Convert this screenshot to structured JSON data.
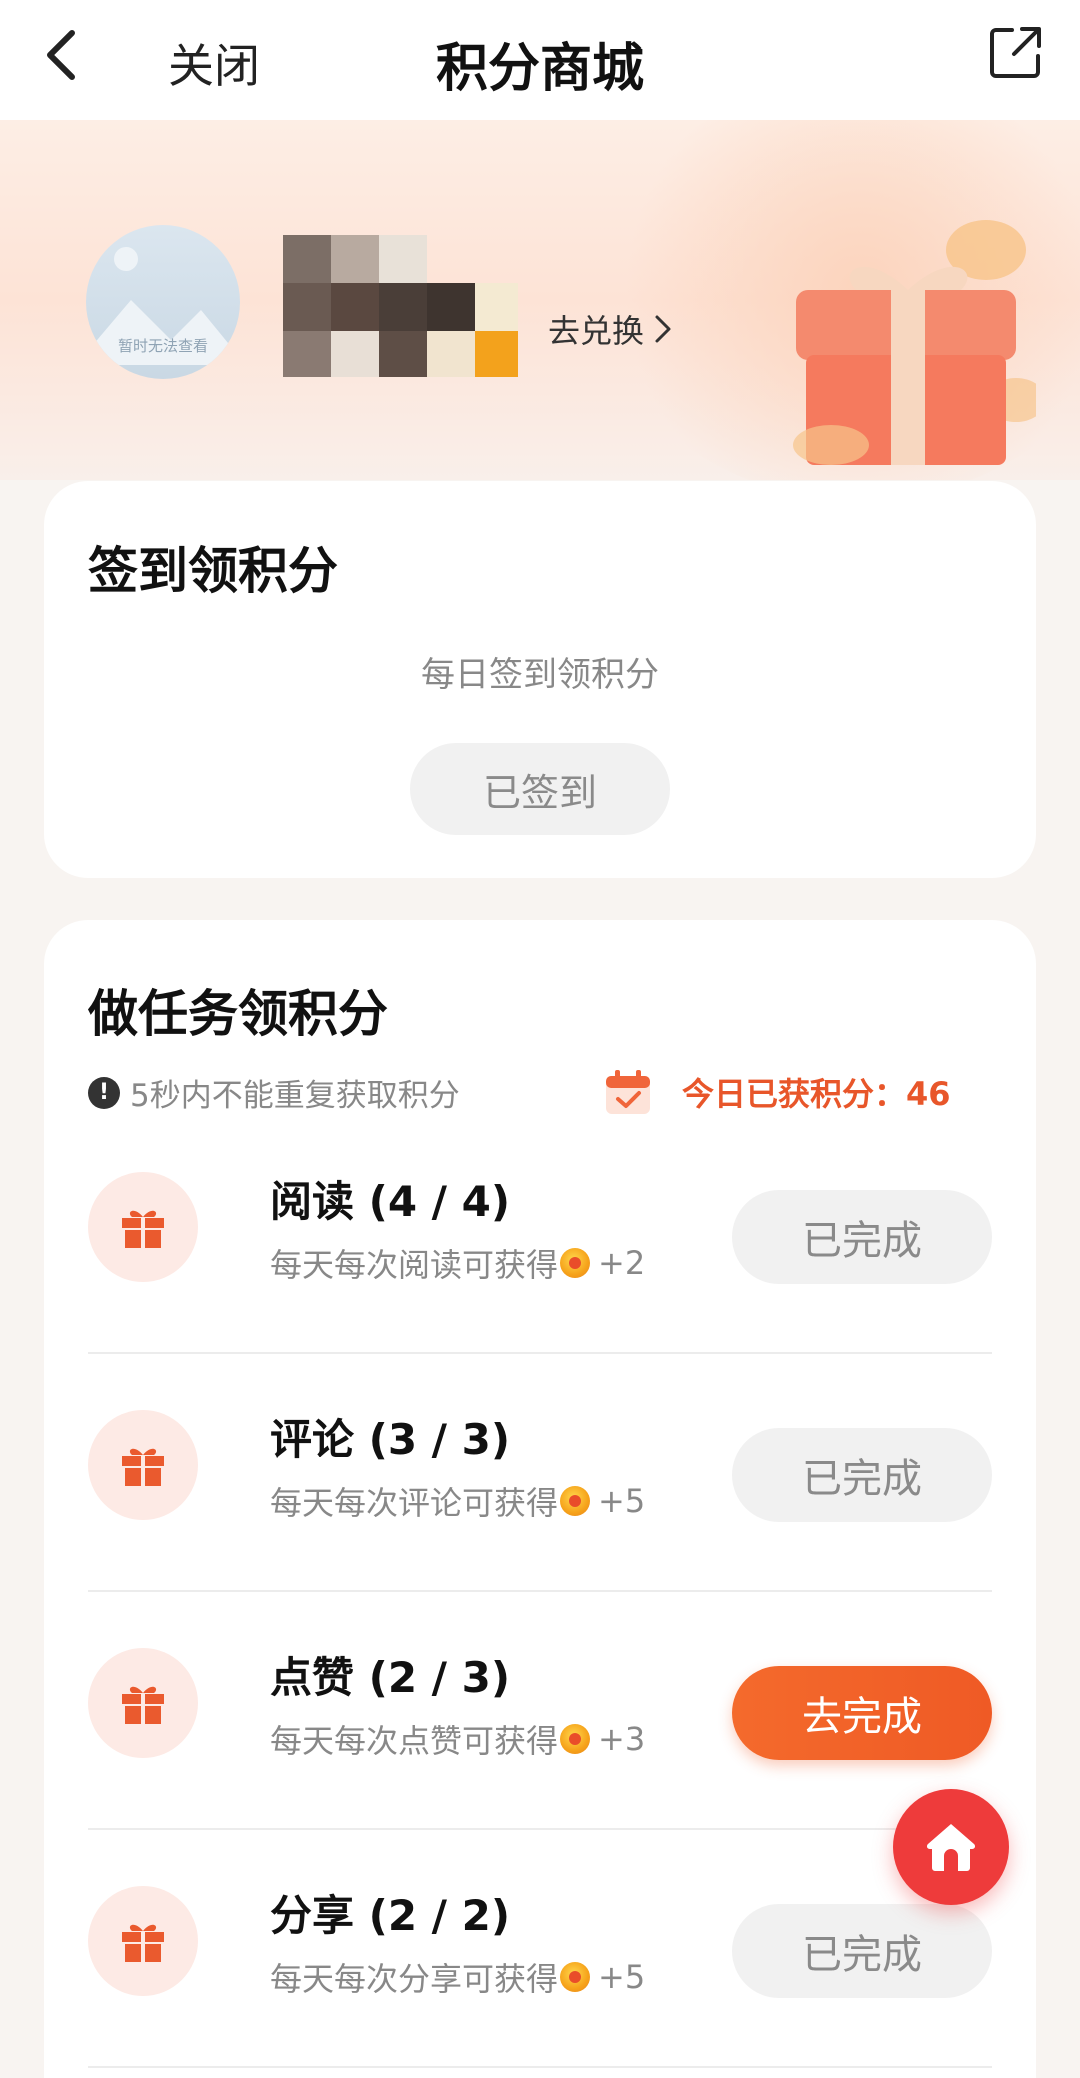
{
  "nav": {
    "title": "积分商城",
    "close_label": "关闭",
    "back_icon": "chevron-left-icon",
    "share_icon": "share-external-icon"
  },
  "profile": {
    "avatar_caption": "暂时无法查看",
    "exchange_label": "去兑换"
  },
  "sign_in": {
    "title": "签到领积分",
    "subtitle": "每日签到领积分",
    "button_label": "已签到"
  },
  "tasks_section": {
    "title": "做任务领积分",
    "notice": "5秒内不能重复获取积分",
    "today_points_label": "今日已获积分：46",
    "items": [
      {
        "name": "阅读 (4 / 4)",
        "desc": "每天每次阅读可获得",
        "reward": "+2",
        "button": "已完成",
        "status": "done"
      },
      {
        "name": "评论 (3 / 3)",
        "desc": "每天每次评论可获得",
        "reward": "+5",
        "button": "已完成",
        "status": "done"
      },
      {
        "name": "点赞 (2 / 3)",
        "desc": "每天每次点赞可获得",
        "reward": "+3",
        "button": "去完成",
        "status": "todo"
      },
      {
        "name": "分享 (2 / 2)",
        "desc": "每天每次分享可获得",
        "reward": "+5",
        "button": "已完成",
        "status": "done"
      }
    ]
  },
  "colors": {
    "accent": "#ef5a25",
    "home_button": "#ee3b3b",
    "done_button_bg": "#f1f1f1"
  },
  "fab": {
    "icon": "home-icon"
  }
}
